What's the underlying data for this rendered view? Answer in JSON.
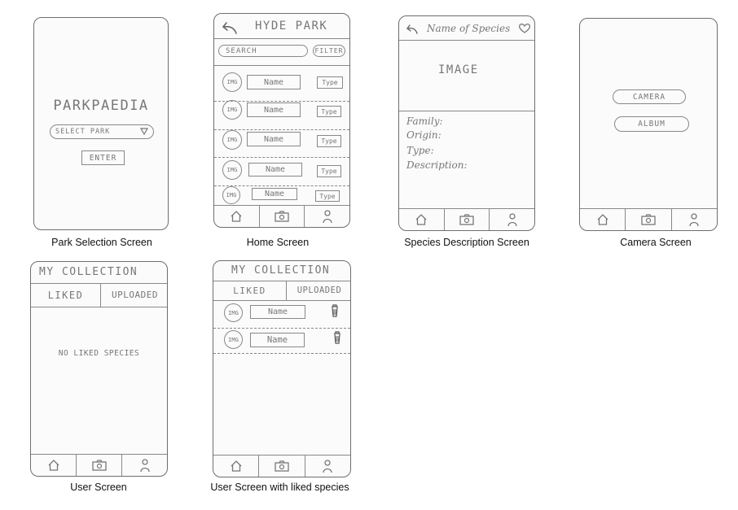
{
  "captions": {
    "park_selection": "Park Selection Screen",
    "home": "Home Screen",
    "species_description": "Species Description Screen",
    "camera": "Camera Screen",
    "user": "User Screen",
    "user_liked": "User Screen with liked species"
  },
  "park_selection": {
    "app_title": "PARKPAEDIA",
    "select_placeholder": "SELECT PARK",
    "enter_label": "ENTER"
  },
  "home": {
    "title": "HYDE PARK",
    "search_label": "SEARCH",
    "filter_label": "FILTER",
    "items": [
      {
        "img": "IMG",
        "name": "Name",
        "type": "Type"
      },
      {
        "img": "IMG",
        "name": "Name",
        "type": "Type"
      },
      {
        "img": "IMG",
        "name": "Name",
        "type": "Type"
      },
      {
        "img": "IMG",
        "name": "Name",
        "type": "Type"
      },
      {
        "img": "IMG",
        "name": "Name",
        "type": "Type"
      }
    ]
  },
  "species": {
    "title": "Name of Species",
    "image_label": "IMAGE",
    "fields": [
      "Family:",
      "Origin:",
      "Type:",
      "Description:"
    ]
  },
  "camera": {
    "camera_label": "CAMERA",
    "album_label": "ALBUM"
  },
  "user": {
    "title": "MY COLLECTION",
    "tab_liked": "LIKED",
    "tab_uploaded": "UPLOADED",
    "empty_text": "NO LIKED SPECIES"
  },
  "user_liked": {
    "title": "MY COLLECTION",
    "tab_liked": "LIKED",
    "tab_uploaded": "UPLOADED",
    "items": [
      {
        "img": "IMG",
        "name": "Name"
      },
      {
        "img": "IMG",
        "name": "Name"
      }
    ]
  },
  "icons": [
    "back-arrow-icon",
    "heart-icon",
    "home-icon",
    "camera-icon",
    "user-icon",
    "dropdown-triangle-icon",
    "trash-icon"
  ]
}
